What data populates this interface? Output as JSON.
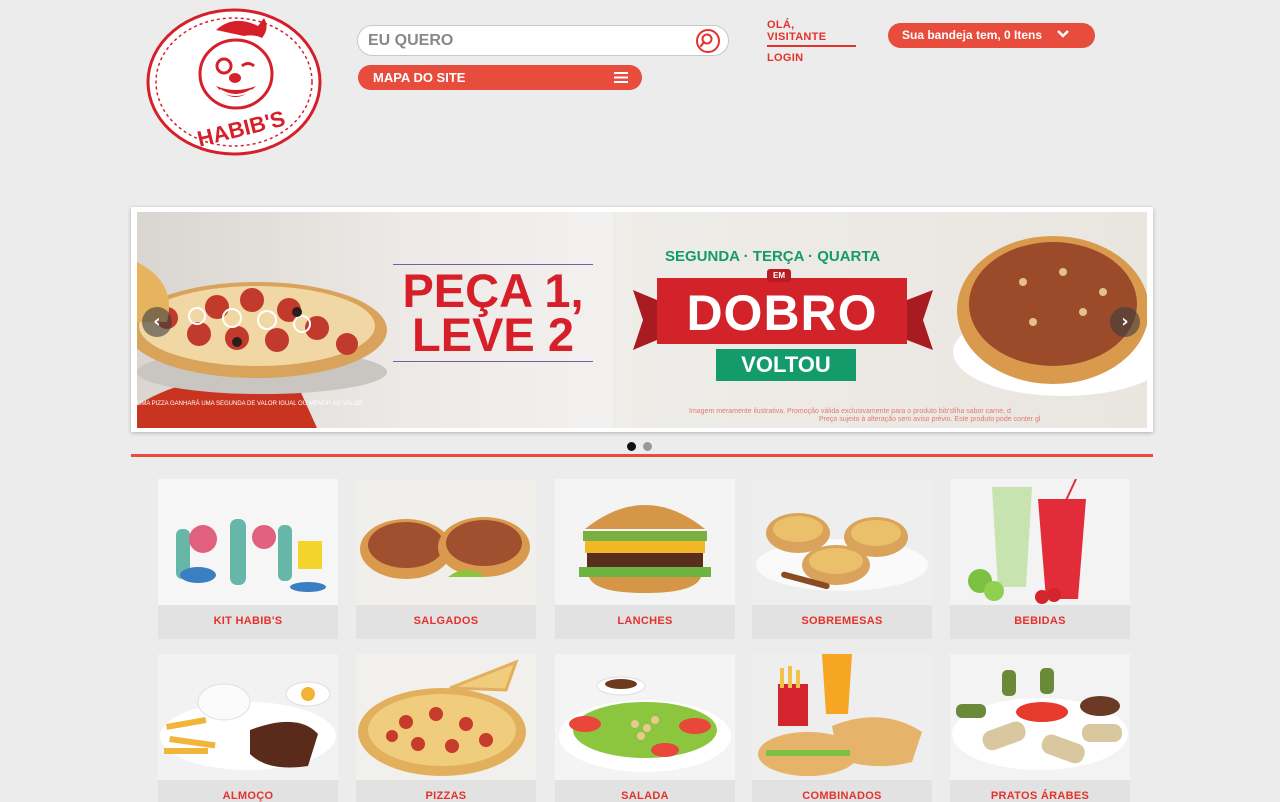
{
  "header": {
    "logo_text": "HABIB'S",
    "search_placeholder": "EU QUERO",
    "sitemap_label": "MAPA DO SITE",
    "greeting": "OLÁ, VISITANTE",
    "login": "LOGIN",
    "tray": "Sua bandeja tem, 0 Itens"
  },
  "banner": {
    "slide1_line1": "PEÇA 1,",
    "slide1_line2": "LEVE 2",
    "slide1_fine": "UMA PIZZA GANHARÁ UMA SEGUNDA DE VALOR IGUAL OU MENOR AO VALOR",
    "slide2_days": "SEGUNDA · TERÇA · QUARTA",
    "slide2_em": "EM",
    "slide2_dobro": "DOBRO",
    "slide2_voltou": "VOLTOU",
    "slide2_fine1": "Imagem meramente ilustrativa. Promoção válida exclusivamente para o produto bib'sfiha sabor carne, d",
    "slide2_fine2": "Preço sujeito à alteração sem aviso prévio. Este produto pode conter gl",
    "prev": "‹",
    "next": "›"
  },
  "categories": [
    {
      "label": "KIT HABIB'S"
    },
    {
      "label": "SALGADOS"
    },
    {
      "label": "LANCHES"
    },
    {
      "label": "SOBREMESAS"
    },
    {
      "label": "BEBIDAS"
    },
    {
      "label": "ALMOÇO"
    },
    {
      "label": "PIZZAS"
    },
    {
      "label": "SALADA"
    },
    {
      "label": "COMBINADOS"
    },
    {
      "label": "PRATOS ÁRABES"
    }
  ],
  "colors": {
    "brand": "#e4322b",
    "button": "#e84c3d",
    "green": "#139b6b"
  }
}
